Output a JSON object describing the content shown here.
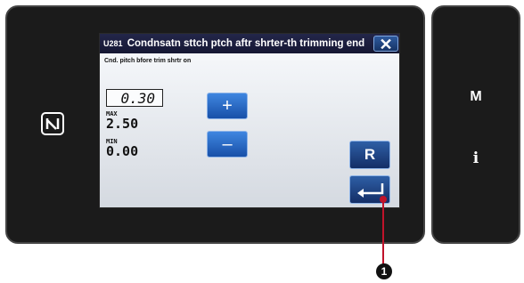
{
  "panel": {
    "title_code": "U281",
    "title_text": "Condnsatn sttch ptch aftr shrter-th trimming end",
    "close_label": "✕",
    "setting_label": "Cnd. pitch bfore trim shrtr on",
    "current_value": "0.30",
    "max_label": "MAX",
    "max_value": "2.50",
    "min_label": "MIN",
    "min_value": "0.00",
    "plus_label": "+",
    "minus_label": "–",
    "reset_label": "R",
    "enter_icon": "enter-icon"
  },
  "side_keys": {
    "m_label": "M",
    "i_label": "i",
    "nfc_icon": "nfc-icon"
  },
  "callout": {
    "number": "1"
  },
  "colors": {
    "screen_body": "#e8ecf1",
    "title_bar": "#1c1f3d",
    "button_blue": "#2a6ac4",
    "callout_red": "#c0132a"
  }
}
